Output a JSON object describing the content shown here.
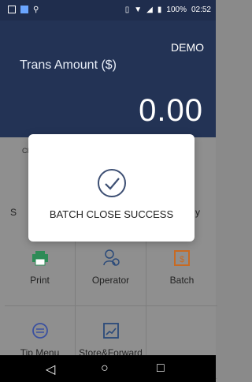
{
  "status": {
    "battery": "100%",
    "time": "02:52"
  },
  "header": {
    "demo": "DEMO",
    "trans_label": "Trans Amount ($)",
    "amount": "0.00"
  },
  "grid": {
    "cr_label": "CR",
    "row2_left": "S",
    "row2_right": "y",
    "items": [
      {
        "label": "Print",
        "icon": "printer-icon"
      },
      {
        "label": "Operator",
        "icon": "operator-icon"
      },
      {
        "label": "Batch",
        "icon": "batch-icon"
      },
      {
        "label": "Tip Menu",
        "icon": "tip-icon"
      },
      {
        "label": "Store&Forward",
        "icon": "store-forward-icon"
      }
    ]
  },
  "dialog": {
    "message": "BATCH CLOSE SUCCESS",
    "icon": "checkmark-icon"
  },
  "nav": {
    "back": "◁",
    "home": "○",
    "recent": "□"
  },
  "colors": {
    "header": "#233355",
    "statusbar": "#1f2d4d",
    "dim": "#8f8f8f",
    "accent": "#2a4a7a"
  }
}
